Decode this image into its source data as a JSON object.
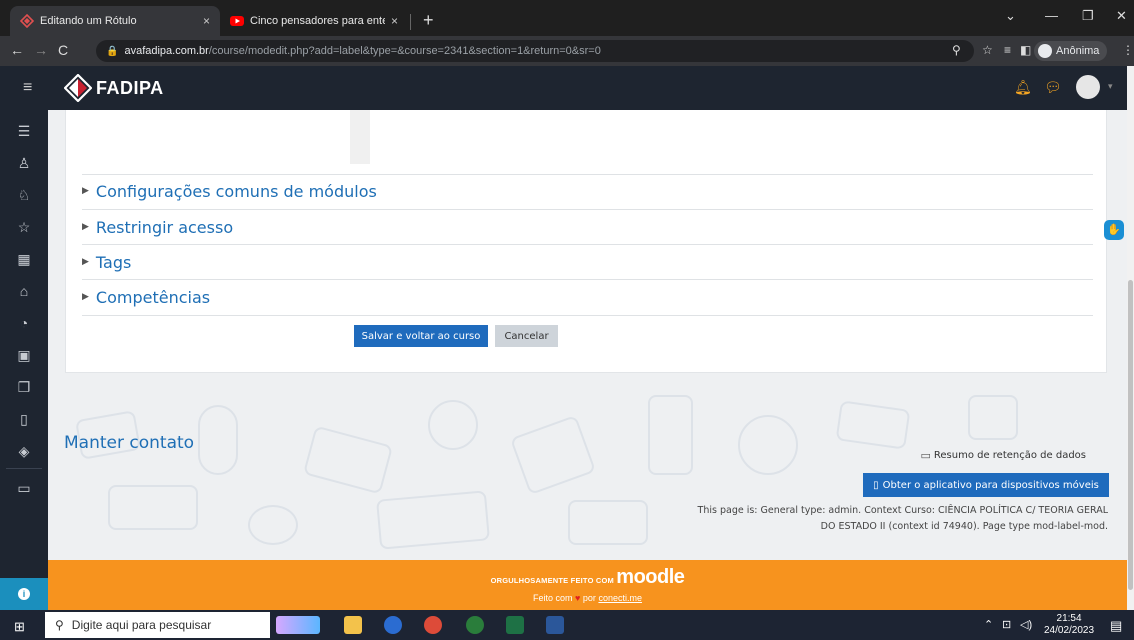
{
  "browser": {
    "tabs": [
      {
        "label": "Editando um Rótulo",
        "close": "×"
      },
      {
        "label": "Cinco pensadores para entender",
        "close": "×"
      }
    ],
    "new_tab": "+",
    "url_host": "avafadipa.com.br",
    "url_path": "/course/modedit.php?add=label&type=&course=2341&section=1&return=0&sr=0",
    "profile_label": "Anônima"
  },
  "navbar": {
    "brand": "FADIPA"
  },
  "form": {
    "sections": [
      {
        "label": "Configurações comuns de módulos"
      },
      {
        "label": "Restringir acesso"
      },
      {
        "label": "Tags"
      },
      {
        "label": "Competências"
      }
    ],
    "save_label": "Salvar e voltar ao curso",
    "cancel_label": "Cancelar"
  },
  "footer": {
    "contact": "Manter contato",
    "retention": "Resumo de retenção de dados",
    "app_button": "Obter o aplicativo para dispositivos móveis",
    "page_info": "This page is: General type: admin. Context Curso: CIÊNCIA POLÍTICA C/ TEORIA GERAL DO ESTADO II (context id 74940). Page type mod-label-mod.",
    "made_with": "ORGULHOSAMENTE FEITO COM",
    "moodle": "moodle",
    "made_by_prefix": "Feito com",
    "made_by_mid": "por",
    "made_by_link": "conecti.me"
  },
  "taskbar": {
    "search_placeholder": "Digite aqui para pesquisar",
    "time": "21:54",
    "date": "24/02/2023"
  },
  "colors": {
    "link": "#1f6fb5",
    "primary": "#1f6bbd",
    "footer_orange": "#f7931e",
    "navbar": "#1e2530"
  }
}
